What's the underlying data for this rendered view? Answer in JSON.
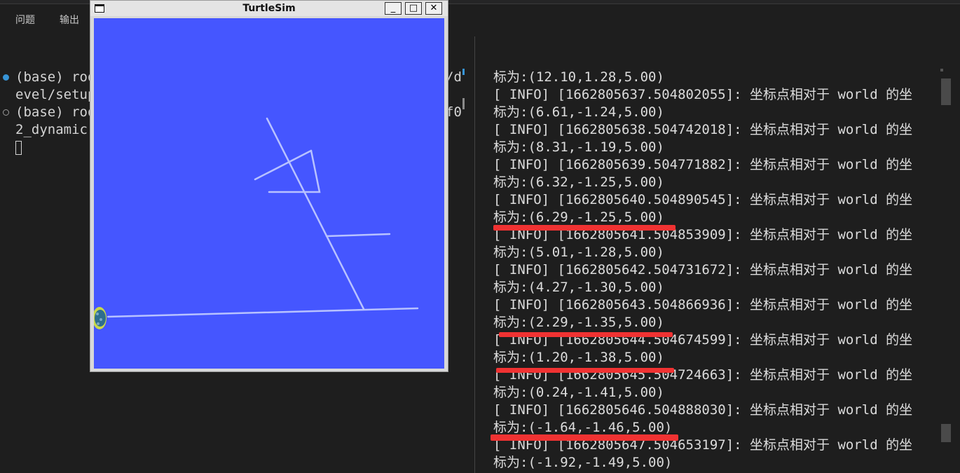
{
  "panel": {
    "tabs": [
      "问题",
      "输出"
    ]
  },
  "left_terminal": {
    "lines": [
      "(base) roo",
      "evel/setup",
      "(base) roo",
      "2_dynamic"
    ],
    "right_fragments": [
      "/d",
      "f0"
    ]
  },
  "turtlesim": {
    "title": "TurtleSim",
    "buttons": {
      "minimize": "_",
      "maximize": "□",
      "close": "✕"
    },
    "background_color": "#4556ff",
    "trail_color": "#b8c2ff"
  },
  "log": {
    "lines": [
      "标为:(12.10,1.28,5.00)",
      "[ INFO] [1662805637.504802055]: 坐标点相对于 world 的坐",
      "标为:(6.61,-1.24,5.00)",
      "[ INFO] [1662805638.504742018]: 坐标点相对于 world 的坐",
      "标为:(8.31,-1.19,5.00)",
      "[ INFO] [1662805639.504771882]: 坐标点相对于 world 的坐",
      "标为:(6.32,-1.25,5.00)",
      "[ INFO] [1662805640.504890545]: 坐标点相对于 world 的坐",
      "标为:(6.29,-1.25,5.00)",
      "[ INFO] [1662805641.504853909]: 坐标点相对于 world 的坐",
      "标为:(5.01,-1.28,5.00)",
      "[ INFO] [1662805642.504731672]: 坐标点相对于 world 的坐",
      "标为:(4.27,-1.30,5.00)",
      "[ INFO] [1662805643.504866936]: 坐标点相对于 world 的坐",
      "标为:(2.29,-1.35,5.00)",
      "[ INFO] [1662805644.504674599]: 坐标点相对于 world 的坐",
      "标为:(1.20,-1.38,5.00)",
      "[ INFO] [1662805645.504724663]: 坐标点相对于 world 的坐",
      "标为:(0.24,-1.41,5.00)",
      "[ INFO] [1662805646.504888030]: 坐标点相对于 world 的坐",
      "标为:(-1.64,-1.46,5.00)",
      "[ INFO] [1662805647.504653197]: 坐标点相对于 world 的坐",
      "标为:(-1.92,-1.49,5.00)"
    ],
    "highlight_color": "#f03232"
  }
}
